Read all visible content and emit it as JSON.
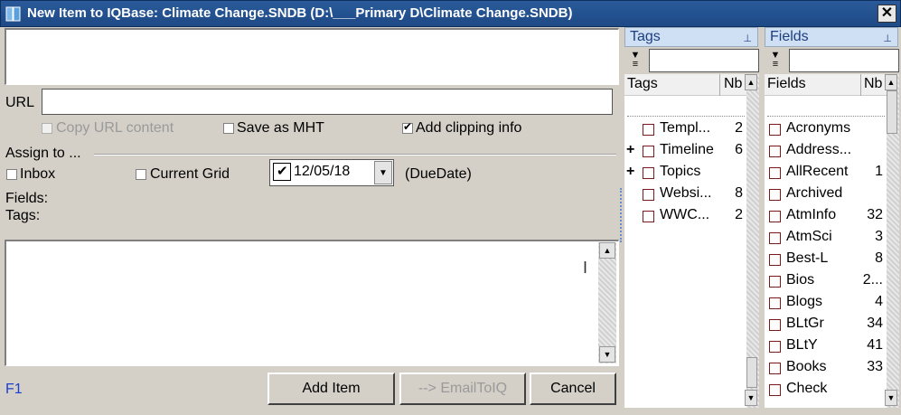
{
  "window": {
    "title": "New Item to IQBase: Climate Change.SNDB (D:\\___Primary D\\Climate Change.SNDB)",
    "close_glyph": "✕"
  },
  "form": {
    "url_label": "URL",
    "url_value": "",
    "copy_url_label": "Copy URL content",
    "copy_url_checked": false,
    "save_mht_label": "Save as MHT",
    "save_mht_checked": false,
    "add_clipping_label": "Add clipping info",
    "add_clipping_checked": true,
    "assign_to_label": "Assign to ...",
    "inbox_label": "Inbox",
    "current_grid_label": "Current Grid",
    "due_date_value": "12/05/18",
    "due_date_checked": true,
    "due_date_label": "(DueDate)",
    "fields_label": "Fields:",
    "tags_label": "Tags:",
    "f1_label": "F1"
  },
  "buttons": {
    "add_item": "Add Item",
    "email_to_iq": "--> EmailToIQ",
    "cancel": "Cancel"
  },
  "tags_panel": {
    "title": "Tags",
    "pin_glyph": "⊥",
    "col_name": "Tags",
    "col_nb": "Nb",
    "rows": [
      {
        "expand": "",
        "name": "Templ...",
        "nb": "2"
      },
      {
        "expand": "+",
        "name": "Timeline",
        "nb": "6"
      },
      {
        "expand": "+",
        "name": "Topics",
        "nb": ""
      },
      {
        "expand": "",
        "name": "Websi...",
        "nb": "8"
      },
      {
        "expand": "",
        "name": "WWC...",
        "nb": "2"
      }
    ]
  },
  "fields_panel": {
    "title": "Fields",
    "pin_glyph": "⊥",
    "col_name": "Fields",
    "col_nb": "Nb",
    "rows": [
      {
        "name": "Acronyms",
        "nb": ""
      },
      {
        "name": "Address...",
        "nb": ""
      },
      {
        "name": "AllRecent",
        "nb": "1"
      },
      {
        "name": "Archived",
        "nb": ""
      },
      {
        "name": "AtmInfo",
        "nb": "32"
      },
      {
        "name": "AtmSci",
        "nb": "3"
      },
      {
        "name": "Best-L",
        "nb": "8"
      },
      {
        "name": "Bios",
        "nb": "2..."
      },
      {
        "name": "Blogs",
        "nb": "4"
      },
      {
        "name": "BLtGr",
        "nb": "34"
      },
      {
        "name": "BLtY",
        "nb": "41"
      },
      {
        "name": "Books",
        "nb": "33"
      },
      {
        "name": "Check",
        "nb": ""
      }
    ]
  }
}
